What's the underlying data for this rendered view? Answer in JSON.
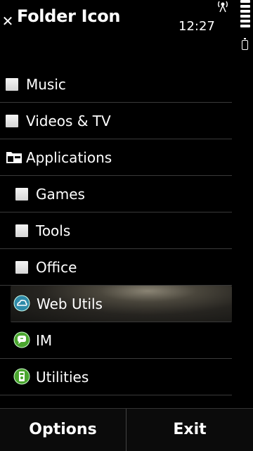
{
  "header": {
    "title": "Folder Icon",
    "time": "12:27"
  },
  "list": [
    {
      "label": "Music",
      "icon": "blank-square-icon"
    },
    {
      "label": "Videos & TV",
      "icon": "blank-square-icon"
    },
    {
      "label": "Applications",
      "icon": "folder-icon"
    },
    {
      "label": "Games",
      "icon": "blank-square-icon"
    },
    {
      "label": "Tools",
      "icon": "blank-square-icon"
    },
    {
      "label": "Office",
      "icon": "blank-square-icon"
    },
    {
      "label": "Web Utils",
      "icon": "cloud-icon",
      "selected": true
    },
    {
      "label": "IM",
      "icon": "chat-icon"
    },
    {
      "label": "Utilities",
      "icon": "utilities-icon"
    }
  ],
  "softkeys": {
    "left": "Options",
    "right": "Exit"
  },
  "colors": {
    "highlight": "#4a463c",
    "app_icon_green": "#5bb33a",
    "app_icon_blue": "#3a9ab8"
  }
}
